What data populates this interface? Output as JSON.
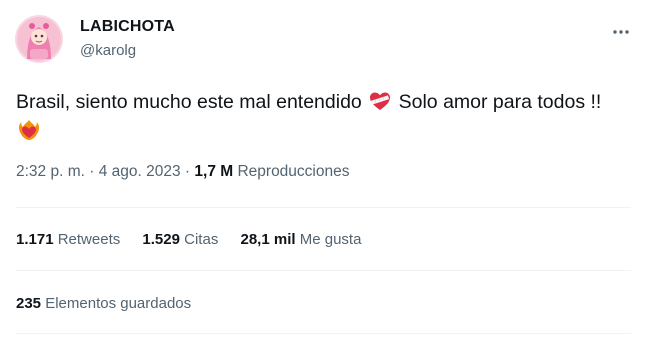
{
  "author": {
    "display_name": "LABICHOTA",
    "handle": "@karolg",
    "avatar": "avatar-image"
  },
  "more_icon": "more-options-icon",
  "tweet": {
    "text_part1": "Brasil, siento mucho este mal entendido",
    "text_part2": " Solo amor para todos !!",
    "emoji_1": "mending-heart-emoji",
    "emoji_2": "heart-on-fire-emoji"
  },
  "meta": {
    "time": "2:32 p. m.",
    "sep1": " · ",
    "date": "4 ago. 2023",
    "sep2": " · ",
    "views_count": "1,7 M",
    "views_label": "Reproducciones"
  },
  "stats": {
    "retweets_count": "1.171",
    "retweets_label": "Retweets",
    "quotes_count": "1.529",
    "quotes_label": "Citas",
    "likes_count": "28,1 mil",
    "likes_label": "Me gusta"
  },
  "bookmarks": {
    "count": "235",
    "label": "Elementos guardados"
  },
  "colors": {
    "text_primary": "#0f1419",
    "text_secondary": "#536471",
    "divider": "#eff3f4",
    "avatar_pink": "#f7c6d6"
  }
}
